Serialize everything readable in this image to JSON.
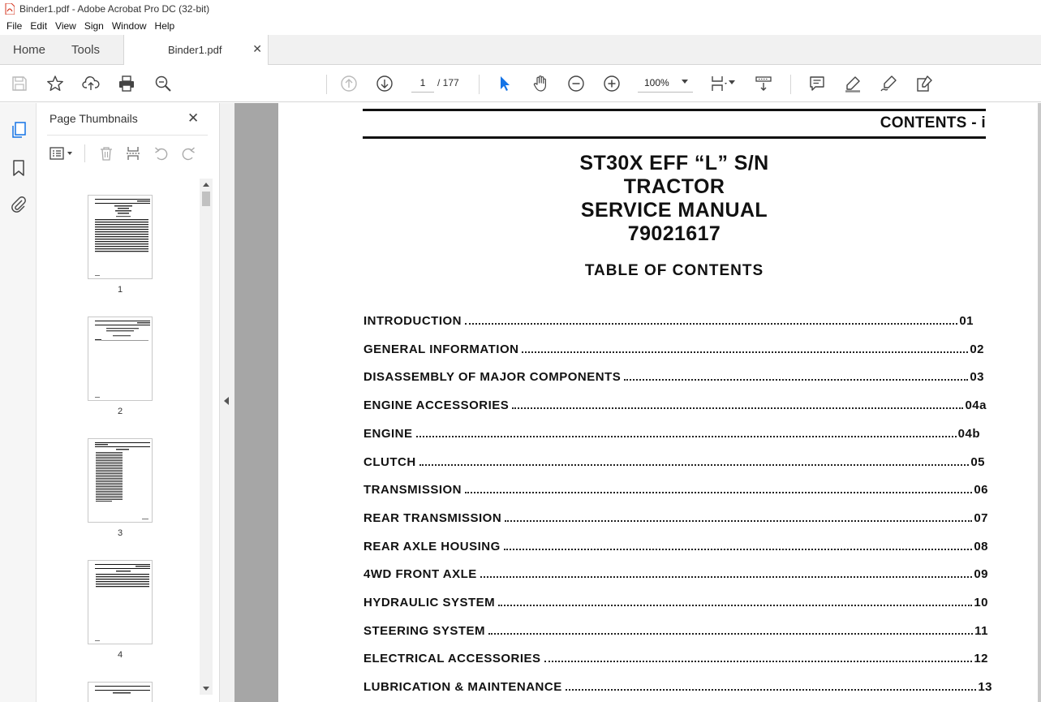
{
  "window": {
    "title": "Binder1.pdf - Adobe Acrobat Pro DC (32-bit)"
  },
  "menu": [
    "File",
    "Edit",
    "View",
    "Sign",
    "Window",
    "Help"
  ],
  "tabs": {
    "home": "Home",
    "tools": "Tools",
    "document": "Binder1.pdf",
    "close": "✕"
  },
  "toolbar": {
    "page_current": "1",
    "page_total": "/ 177",
    "zoom": "100%"
  },
  "thumbnails": {
    "title": "Page Thumbnails",
    "close": "✕",
    "pages": [
      "1",
      "2",
      "3",
      "4"
    ]
  },
  "document": {
    "header": "CONTENTS - i",
    "title_lines": [
      "ST30X EFF “L” S/N",
      "TRACTOR",
      "SERVICE MANUAL",
      "79021617"
    ],
    "toc_heading": "TABLE OF CONTENTS",
    "toc": [
      {
        "title": "INTRODUCTION",
        "num": "01"
      },
      {
        "title": "GENERAL INFORMATION",
        "num": "02"
      },
      {
        "title": "DISASSEMBLY OF MAJOR COMPONENTS",
        "num": "03"
      },
      {
        "title": "ENGINE ACCESSORIES",
        "num": "04a"
      },
      {
        "title": "ENGINE",
        "num": "04b"
      },
      {
        "title": "CLUTCH",
        "num": "05"
      },
      {
        "title": "TRANSMISSION",
        "num": "06"
      },
      {
        "title": "REAR TRANSMISSION",
        "num": "07"
      },
      {
        "title": "REAR AXLE HOUSING",
        "num": "08"
      },
      {
        "title": "4WD FRONT AXLE",
        "num": "09"
      },
      {
        "title": "HYDRAULIC SYSTEM",
        "num": "10"
      },
      {
        "title": "STEERING SYSTEM",
        "num": "11"
      },
      {
        "title": "ELECTRICAL ACCESSORIES",
        "num": "12"
      },
      {
        "title": "LUBRICATION & MAINTENANCE",
        "num": "13"
      }
    ]
  },
  "colors": {
    "accent_blue": "#1473e6",
    "app_red": "#d4331d",
    "doc_background": "#a6a6a6"
  },
  "icons": {
    "rail": [
      "page-thumbnails-icon",
      "bookmark-icon",
      "attachment-icon"
    ],
    "toolbar": [
      "save-icon",
      "star-icon",
      "upload-icon",
      "print-icon",
      "zoom-search-icon",
      "previous-page-icon",
      "next-page-icon",
      "select-cursor-icon",
      "hand-icon",
      "zoom-out-icon",
      "zoom-in-icon",
      "page-fit-icon",
      "scroll-mode-icon",
      "comment-icon",
      "highlight-icon",
      "sign-icon",
      "edit-form-icon"
    ]
  }
}
